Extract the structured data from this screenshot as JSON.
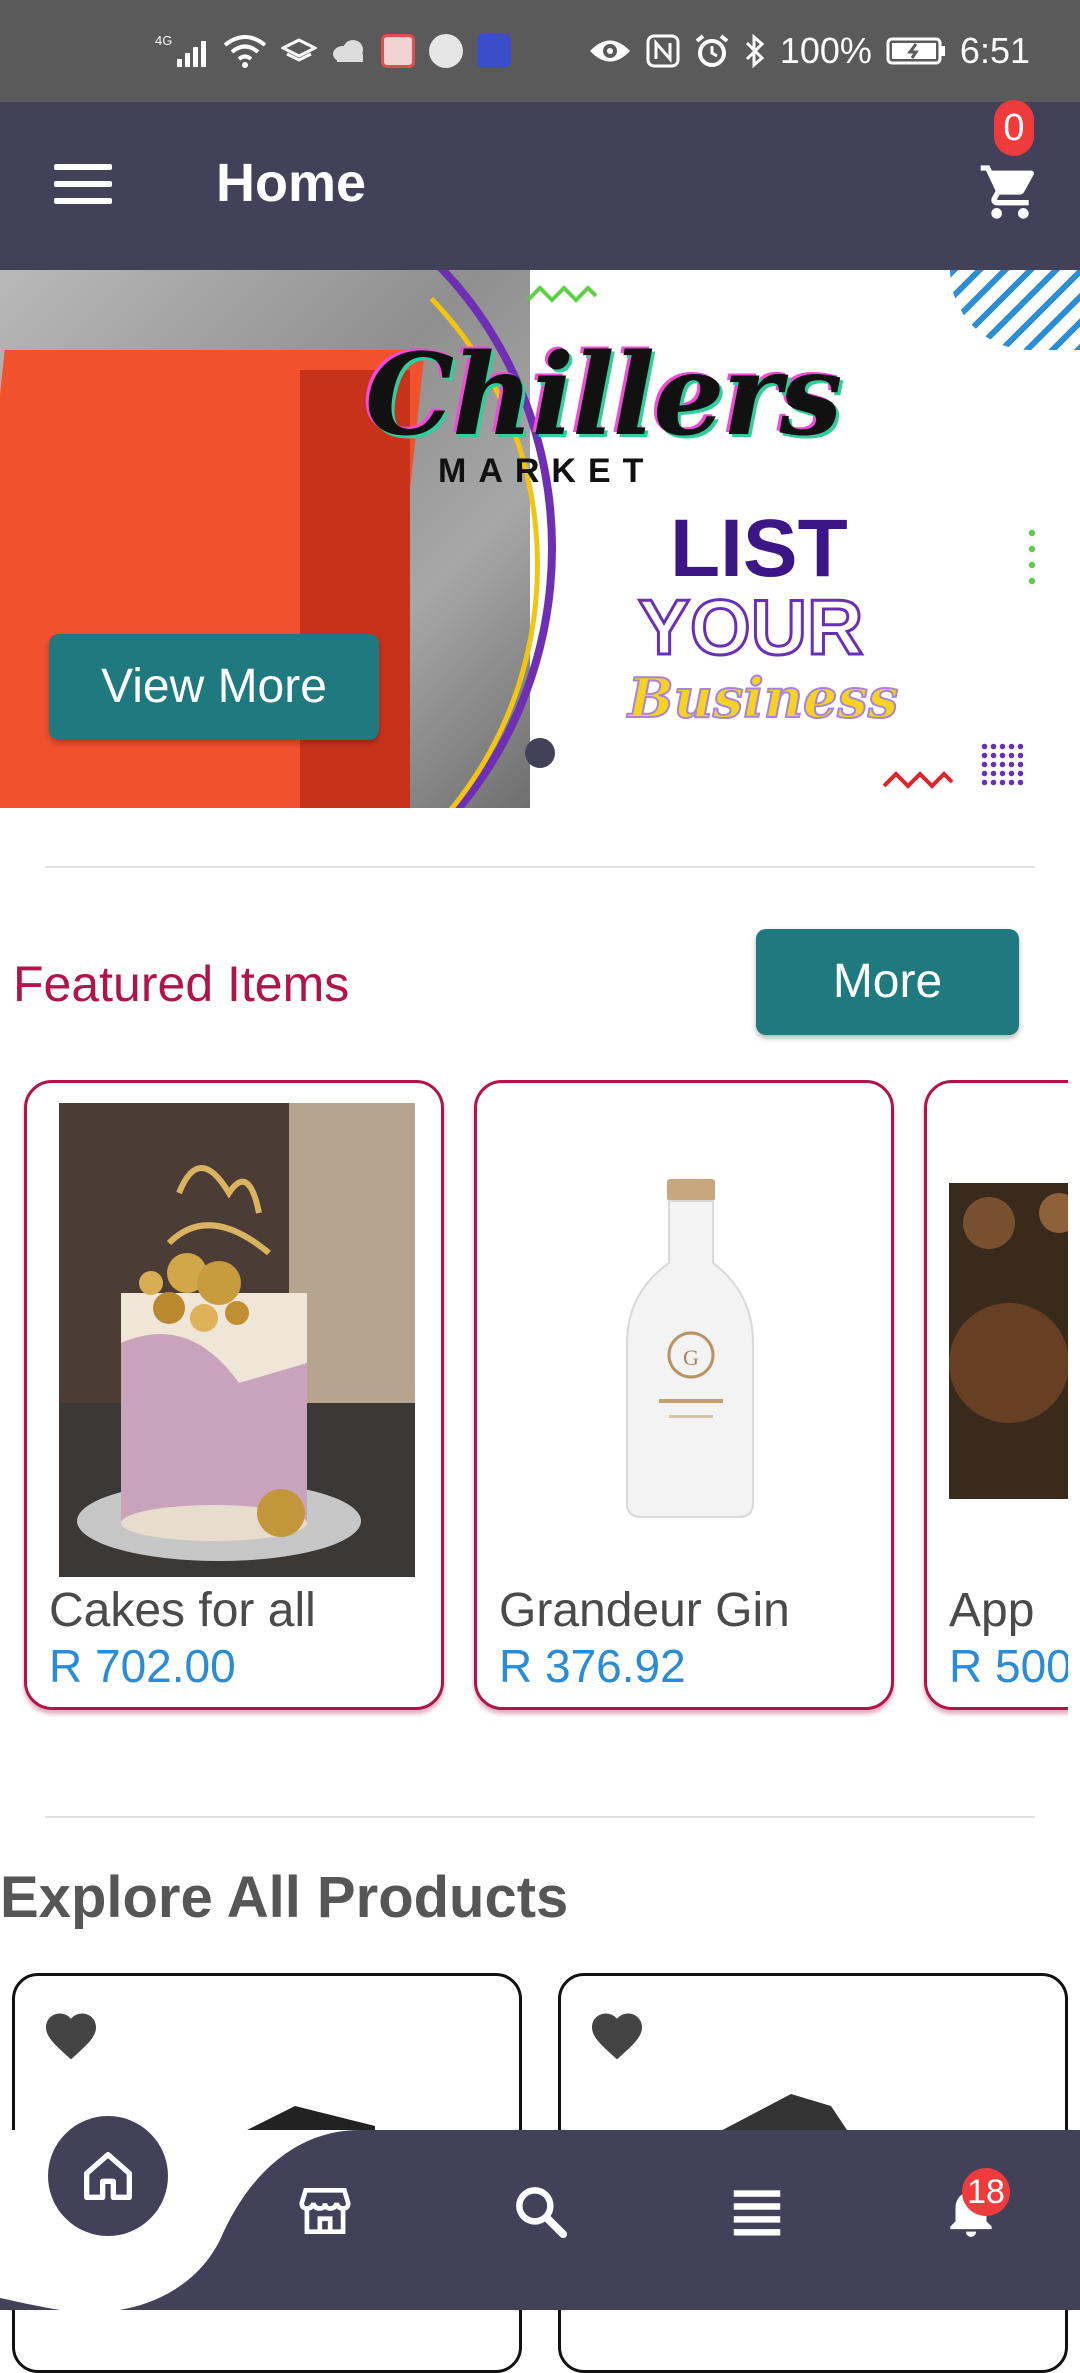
{
  "status_bar": {
    "network": "4G",
    "battery": "100%",
    "time": "6:51"
  },
  "header": {
    "title": "Home",
    "cart_count": "0"
  },
  "banner": {
    "logo": "Chillers",
    "logo_sub": "MARKET",
    "line1": "LIST",
    "line2": "YOUR",
    "line3": "Business",
    "button": "View More"
  },
  "featured": {
    "title": "Featured Items",
    "more_button": "More",
    "items": [
      {
        "name": "Cakes for all",
        "price": "R 702.00"
      },
      {
        "name": "Grandeur Gin",
        "price": "R 376.92"
      },
      {
        "name": "App",
        "price": "R 500"
      }
    ]
  },
  "explore": {
    "title": "Explore All Products"
  },
  "bottom_nav": {
    "notification_count": "18"
  },
  "colors": {
    "header": "#424159",
    "accent_teal": "#1f7a80",
    "featured_red": "#b0144a",
    "price_blue": "#2a8bd6",
    "badge_red": "#ef3b3b"
  }
}
